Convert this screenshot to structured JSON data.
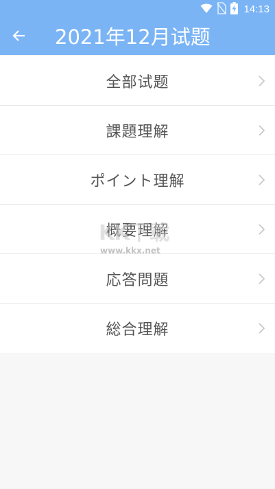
{
  "status_bar": {
    "time": "14:13",
    "icons": [
      "wifi-icon",
      "no-sim-icon",
      "battery-charging-icon"
    ]
  },
  "header": {
    "back_icon": "arrow-left-icon",
    "title": "2021年12月试题",
    "background_color": "#7ab4f5"
  },
  "list": {
    "items": [
      {
        "label": "全部试题"
      },
      {
        "label": "課題理解"
      },
      {
        "label": "ポイント理解"
      },
      {
        "label": "概要理解"
      },
      {
        "label": "応答問題"
      },
      {
        "label": "総合理解"
      }
    ],
    "chevron_icon": "chevron-right-icon"
  },
  "watermark": {
    "logo": "KK下载",
    "url": "www.kkx.net"
  }
}
